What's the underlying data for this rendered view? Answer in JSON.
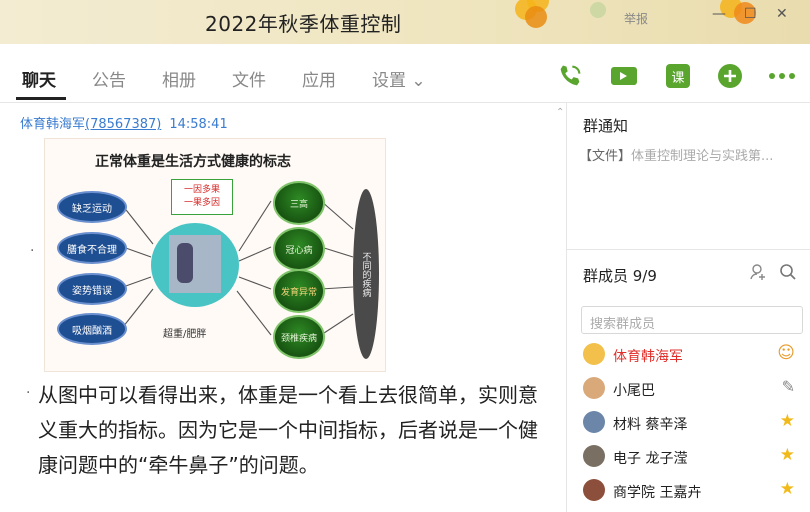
{
  "window": {
    "title": "2022年秋季体重控制",
    "report_label": "举报"
  },
  "tabs": [
    "聊天",
    "公告",
    "相册",
    "文件",
    "应用",
    "设置 ⌄"
  ],
  "toolbar": {
    "lesson_label": "课"
  },
  "message": {
    "sender": "体育韩海军",
    "sender_id": "(78567387)",
    "time": "14:58:41",
    "image": {
      "title": "正常体重是生活方式健康的标志",
      "left_items": [
        "缺乏运动",
        "膳食不合理",
        "姿势错误",
        "吸烟酗酒"
      ],
      "box_lines": [
        "一因多果",
        "一果多因"
      ],
      "right_items": [
        "三高",
        "冠心病",
        "发育异常",
        "颈椎疾病"
      ],
      "end_label": "不同的疾病",
      "caption": "超重/肥胖"
    },
    "text": "从图中可以看得出来，体重是一个看上去很简单，实则意义重大的指标。因为它是一个中间指标，后者说是一个健康问题中的“牵牛鼻子”的问题。"
  },
  "sidebar": {
    "notice_title": "群通知",
    "notice_tag": "【文件】",
    "notice_text": "体重控制理论与实践第...",
    "members_title": "群成员 9/9",
    "search_placeholder": "搜索群成员",
    "members": [
      {
        "name": "体育韩海军",
        "badge": "owner-icon",
        "color": "#e1302b"
      },
      {
        "name": "小尾巴",
        "badge": "edit-icon"
      },
      {
        "name": "材料 蔡辛泽",
        "badge": "star-icon"
      },
      {
        "name": "电子 龙子滢",
        "badge": "star-icon"
      },
      {
        "name": "商学院 王嘉卉",
        "badge": "star-icon"
      }
    ]
  }
}
